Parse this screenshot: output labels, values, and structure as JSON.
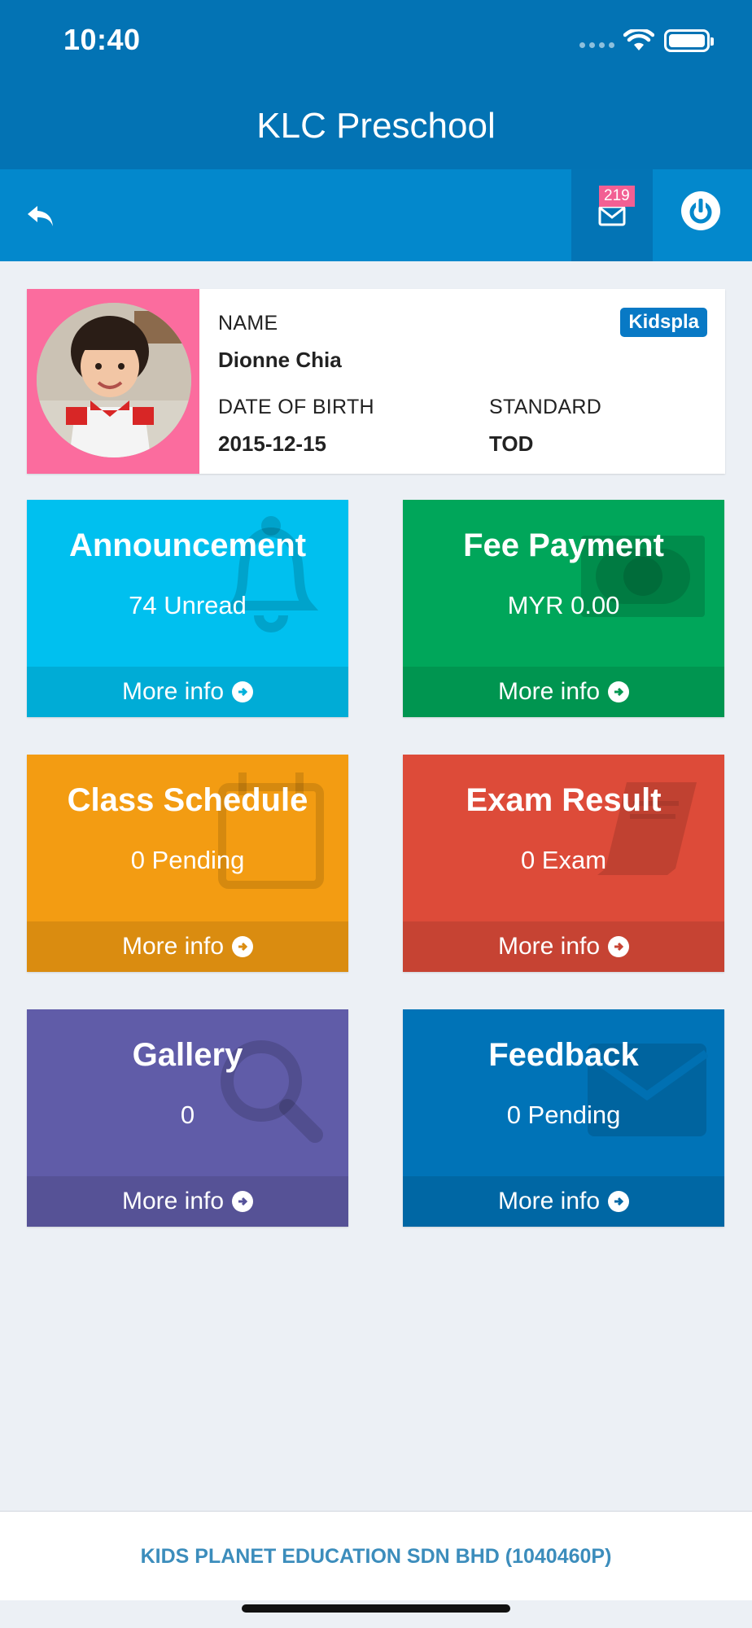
{
  "status_bar": {
    "time": "10:40"
  },
  "header": {
    "title": "KLC Preschool"
  },
  "toolbar": {
    "mail_count": "219"
  },
  "profile": {
    "name_label": "NAME",
    "name": "Dionne Chia",
    "dob_label": "DATE OF BIRTH",
    "dob": "2015-12-15",
    "standard_label": "STANDARD",
    "standard": "TOD",
    "badge": "Kidspla"
  },
  "tiles": [
    {
      "title": "Announcement",
      "subtitle": "74 Unread",
      "footer": "More info",
      "color": "#00c0ef",
      "icon": "bell-icon"
    },
    {
      "title": "Fee Payment",
      "subtitle": "MYR 0.00",
      "footer": "More info",
      "color": "#00a65a",
      "icon": "money-icon"
    },
    {
      "title": "Class Schedule",
      "subtitle": "0 Pending",
      "footer": "More info",
      "color": "#f39c12",
      "icon": "calendar-icon"
    },
    {
      "title": "Exam Result",
      "subtitle": "0 Exam",
      "footer": "More info",
      "color": "#dd4b39",
      "icon": "book-icon"
    },
    {
      "title": "Gallery",
      "subtitle": "0",
      "footer": "More info",
      "color": "#605ca8",
      "icon": "search-icon"
    },
    {
      "title": "Feedback",
      "subtitle": "0 Pending",
      "footer": "More info",
      "color": "#0073b7",
      "icon": "envelope-icon"
    }
  ],
  "footer": {
    "company": "KIDS PLANET EDUCATION SDN BHD (1040460P)"
  }
}
